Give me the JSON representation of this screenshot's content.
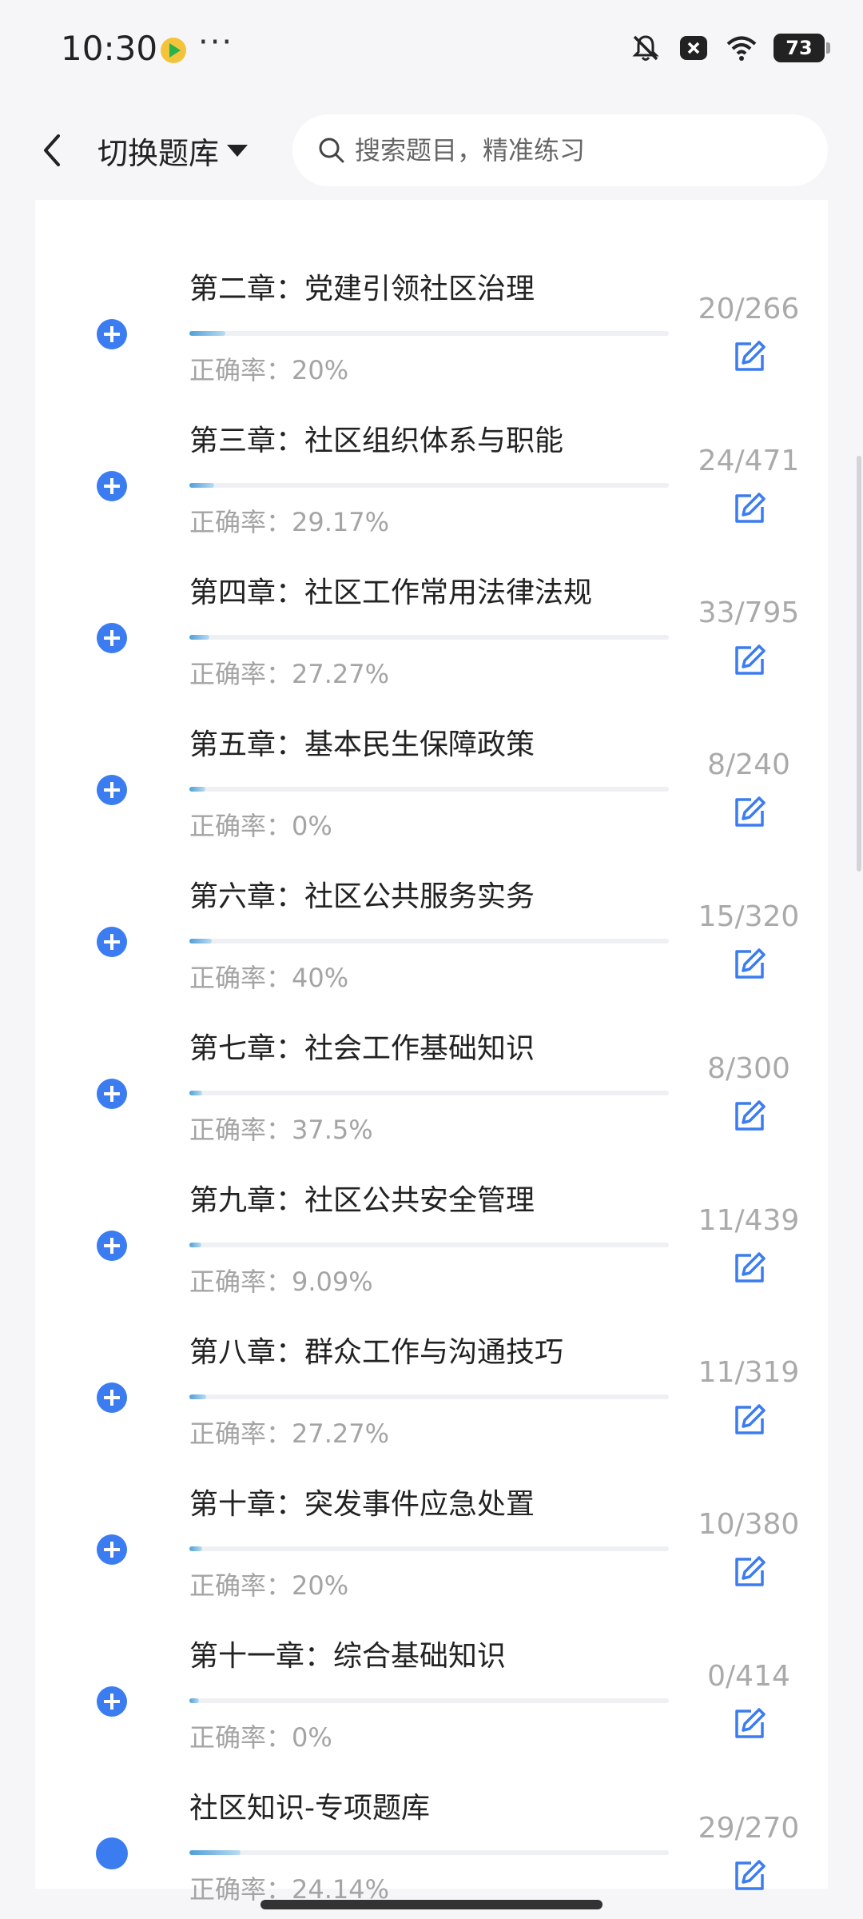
{
  "status_bar": {
    "time": "10:30",
    "more": "···",
    "battery": "73",
    "icons": [
      "bell-off-icon",
      "close-box-icon",
      "wifi-icon"
    ]
  },
  "header": {
    "switch_bank_label": "切换题库",
    "search_placeholder": "搜索题目，精准练习"
  },
  "chapters": [
    {
      "title": "第二章：党建引领社区治理",
      "accuracy": "正确率：20%",
      "done": 20,
      "total": 266,
      "count": "20/266",
      "icon": "add-circle-icon"
    },
    {
      "title": "第三章：社区组织体系与职能",
      "accuracy": "正确率：29.17%",
      "done": 24,
      "total": 471,
      "count": "24/471",
      "icon": "add-circle-icon"
    },
    {
      "title": "第四章：社区工作常用法律法规",
      "accuracy": "正确率：27.27%",
      "done": 33,
      "total": 795,
      "count": "33/795",
      "icon": "add-circle-icon"
    },
    {
      "title": "第五章：基本民生保障政策",
      "accuracy": "正确率：0%",
      "done": 8,
      "total": 240,
      "count": "8/240",
      "icon": "add-circle-icon"
    },
    {
      "title": "第六章：社区公共服务实务",
      "accuracy": "正确率：40%",
      "done": 15,
      "total": 320,
      "count": "15/320",
      "icon": "add-circle-icon"
    },
    {
      "title": "第七章：社会工作基础知识",
      "accuracy": "正确率：37.5%",
      "done": 8,
      "total": 300,
      "count": "8/300",
      "icon": "add-circle-icon"
    },
    {
      "title": "第九章：社区公共安全管理",
      "accuracy": "正确率：9.09%",
      "done": 11,
      "total": 439,
      "count": "11/439",
      "icon": "add-circle-icon"
    },
    {
      "title": "第八章：群众工作与沟通技巧",
      "accuracy": "正确率：27.27%",
      "done": 11,
      "total": 319,
      "count": "11/319",
      "icon": "add-circle-icon"
    },
    {
      "title": "第十章：突发事件应急处置",
      "accuracy": "正确率：20%",
      "done": 10,
      "total": 380,
      "count": "10/380",
      "icon": "add-circle-icon"
    },
    {
      "title": "第十一章：综合基础知识",
      "accuracy": "正确率：0%",
      "done": 0,
      "total": 414,
      "count": "0/414",
      "icon": "add-circle-icon"
    },
    {
      "title": "社区知识-专项题库",
      "accuracy": "正确率：24.14%",
      "done": 29,
      "total": 270,
      "count": "29/270",
      "icon": "dot-icon"
    }
  ],
  "colors": {
    "accent": "#3b7cf0",
    "progress_start": "#4f9fd8",
    "progress_end": "#b8dcf2",
    "muted_text": "#a4a4a4"
  }
}
